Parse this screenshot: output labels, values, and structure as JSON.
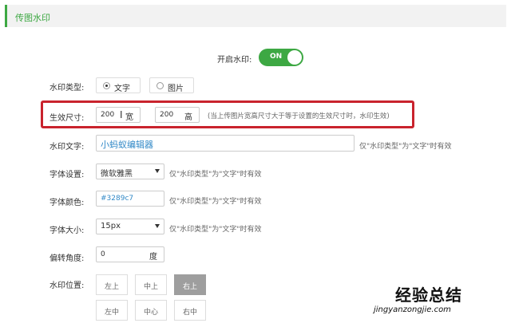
{
  "header": {
    "title": "传图水印"
  },
  "enable": {
    "label": "开启水印:",
    "state": "ON"
  },
  "type": {
    "label": "水印类型:",
    "options": [
      "文字",
      "图片"
    ],
    "selected": "文字"
  },
  "size": {
    "label": "生效尺寸:",
    "width": "200",
    "width_unit": "宽",
    "height": "200",
    "height_unit": "高",
    "hint": "(当上传图片宽高尺寸大于等于设置的生效尺寸时，水印生效)"
  },
  "text": {
    "label": "水印文字:",
    "value": "小蚂蚁编辑器",
    "hint": "仅\"水印类型\"为\"文字\"时有效"
  },
  "font": {
    "label": "字体设置:",
    "value": "微软雅黑",
    "hint": "仅\"水印类型\"为\"文字\"时有效"
  },
  "color": {
    "label": "字体颜色:",
    "value": "#3289c7",
    "hint": "仅\"水印类型\"为\"文字\"时有效"
  },
  "fontsize": {
    "label": "字体大小:",
    "value": "15px",
    "hint": "仅\"水印类型\"为\"文字\"时有效"
  },
  "rotate": {
    "label": "偏转角度:",
    "value": "0",
    "unit": "度"
  },
  "position": {
    "label": "水印位置:",
    "cells": [
      "左上",
      "中上",
      "右上",
      "左中",
      "中心",
      "右中"
    ],
    "selected": "右上"
  },
  "watermark": {
    "cn": "经验总结",
    "url": "jingyanzongjie.com"
  },
  "colors": {
    "accent": "#3da843",
    "highlight": "#c9232d",
    "text_blue": "#3289c7"
  }
}
